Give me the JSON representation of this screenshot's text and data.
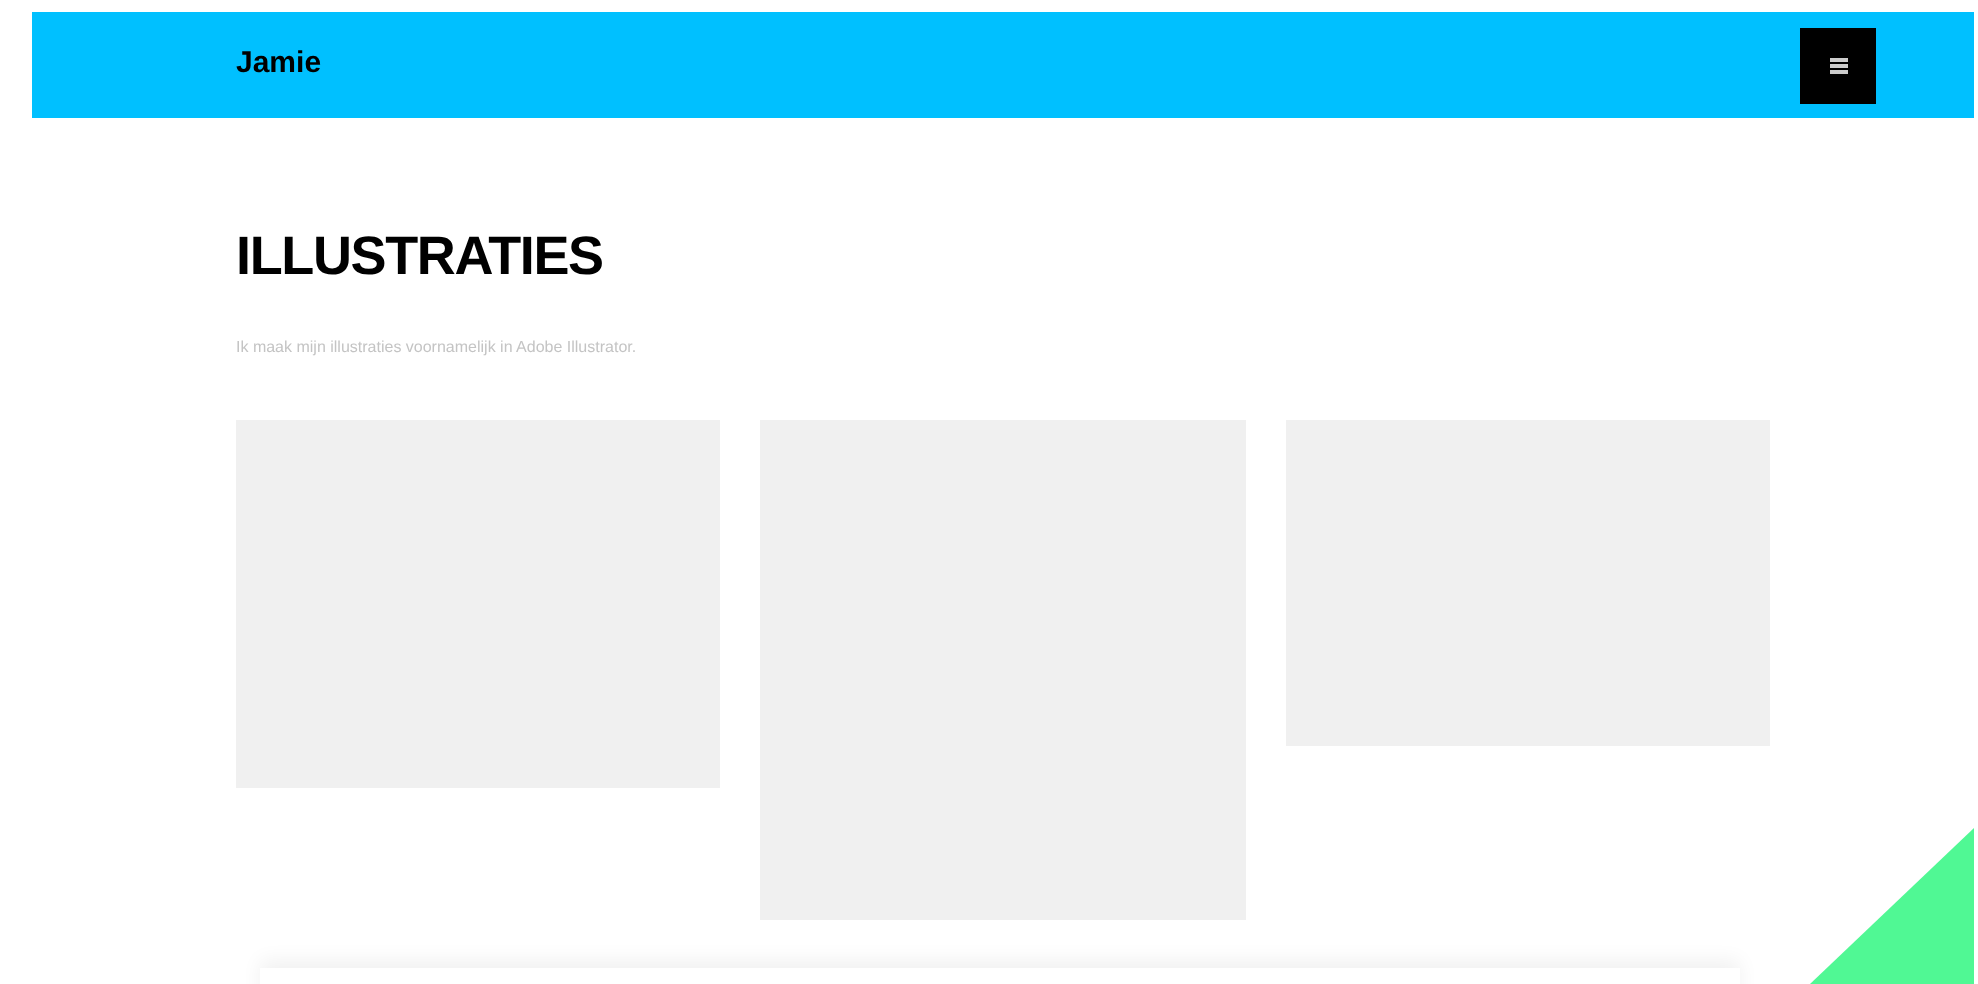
{
  "header": {
    "brand": "Jamie"
  },
  "section": {
    "title": "ILLUSTRATIES",
    "description": "Ik maak mijn illustraties voornamelijk in Adobe Illustrator."
  }
}
